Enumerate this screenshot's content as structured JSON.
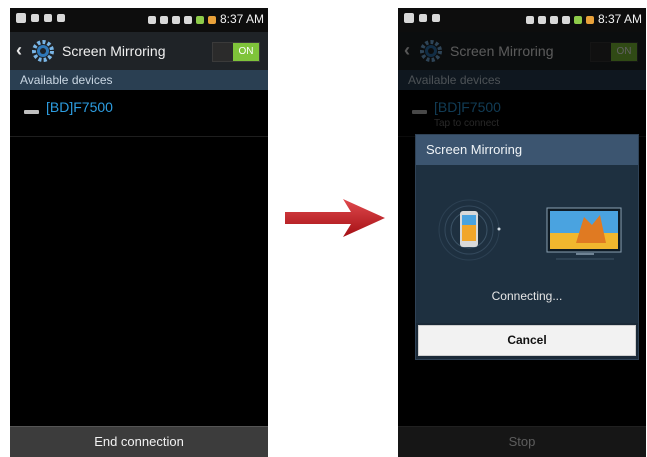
{
  "left_screen": {
    "status_time": "8:37 AM",
    "title": "Screen Mirroring",
    "toggle_label": "ON",
    "section_header": "Available devices",
    "device_name": "[BD]F7500",
    "bottom_button": "End connection"
  },
  "right_screen": {
    "status_time": "8:37 AM",
    "title": "Screen Mirroring",
    "toggle_label": "ON",
    "section_header": "Available devices",
    "device_name": "[BD]F7500",
    "device_subtitle": "Tap to connect",
    "dialog": {
      "title": "Screen Mirroring",
      "status": "Connecting...",
      "cancel_label": "Cancel"
    },
    "bottom_button": "Stop"
  },
  "colors": {
    "accent_link": "#2d9de0",
    "toggle_on": "#7fc43a",
    "arrow": "#c0161b"
  },
  "icons": [
    "back-chevron-icon",
    "gear-icon",
    "toggle-switch",
    "tv-device-icon",
    "phone-icon",
    "tv-icon",
    "arrow-icon"
  ]
}
